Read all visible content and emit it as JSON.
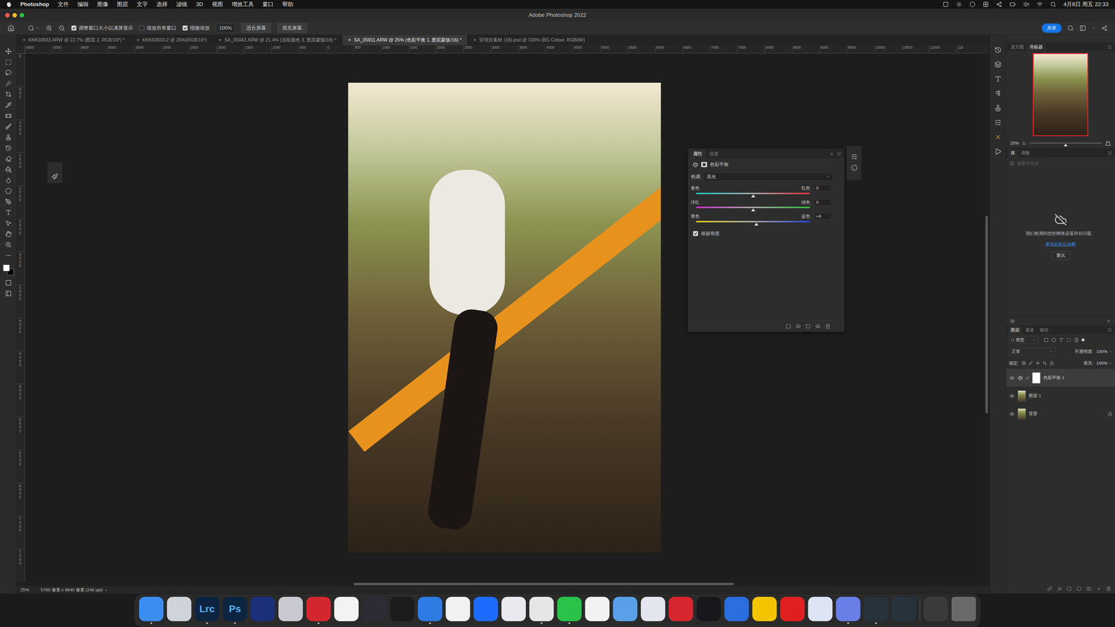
{
  "menubar": {
    "app": "Photoshop",
    "items": [
      "文件",
      "编辑",
      "图像",
      "图层",
      "文字",
      "选择",
      "滤镜",
      "3D",
      "视图",
      "增效工具",
      "窗口",
      "帮助"
    ],
    "clock": "4月8日 周五 22:33"
  },
  "window": {
    "title": "Adobe Photoshop 2022"
  },
  "options_bar": {
    "checkboxes": [
      {
        "label": "调整窗口大小以满屏显示",
        "checked": true
      },
      {
        "label": "缩放所有窗口",
        "checked": false
      },
      {
        "label": "细微缩放",
        "checked": true
      }
    ],
    "zoom": "100%",
    "buttons": [
      "适合屏幕",
      "填充屏幕"
    ],
    "share": "共享"
  },
  "tabs": [
    {
      "label": "KKK02833.ARW @ 22.7% (图层 2, RGB/16*) *",
      "selected": false,
      "close": "×"
    },
    {
      "label": "KKK02833-2 @ 25%(RGB/16*)",
      "selected": false,
      "close": "×"
    },
    {
      "label": "SA_05042.ARW @ 21.4% (选取颜色 3, 图层蒙版/16) *",
      "selected": false,
      "close": "×"
    },
    {
      "label": "SA_05911.ARW @ 25% (色彩平衡 1, 图层蒙版/16) *",
      "selected": true,
      "close": "×"
    },
    {
      "label": "安琪拉素材 (16).psd @ 100% (BG Colour, RGB/8#)",
      "selected": false,
      "close": "×"
    }
  ],
  "rulers": {
    "horizontal": [
      "5500",
      "5000",
      "4500",
      "4000",
      "3500",
      "3000",
      "2500",
      "2000",
      "1500",
      "1000",
      "500",
      "0",
      "500",
      "1000",
      "1500",
      "2000",
      "2500",
      "3000",
      "3500",
      "4000",
      "4500",
      "5000",
      "5500",
      "6000",
      "6500",
      "7000",
      "7500",
      "8000",
      "8500",
      "9000",
      "9500",
      "10000",
      "10500",
      "11000",
      "115"
    ],
    "vertical": [
      "0",
      "500",
      "1000",
      "1500",
      "2000",
      "2500",
      "3000",
      "3500",
      "4000",
      "4500",
      "5000",
      "5500",
      "6000",
      "6500",
      "7000",
      "7500"
    ]
  },
  "status_bar": {
    "zoom": "25%",
    "info": "5760 像素 x 8640 像素 (240 ppi)",
    "arrow": "›"
  },
  "properties": {
    "tabs": [
      {
        "label": "属性",
        "selected": true
      },
      {
        "label": "信息",
        "selected": false
      }
    ],
    "title": "色彩平衡",
    "tone_label": "色调:",
    "tone": "高光",
    "sliders": [
      {
        "left": "青色",
        "right": "红色",
        "value": "0",
        "level": 0.5,
        "left_color": "#19c6c6",
        "right_color": "#e0303a"
      },
      {
        "left": "洋红",
        "right": "绿色",
        "value": "0",
        "level": 0.5,
        "left_color": "#d22fd2",
        "right_color": "#2fbf3a"
      },
      {
        "left": "黄色",
        "right": "蓝色",
        "value": "+6",
        "level": 0.53,
        "left_color": "#e5d21a",
        "right_color": "#2a3ee0"
      }
    ],
    "preserve": {
      "label": "保留明度",
      "checked": true
    }
  },
  "navigator": {
    "tabs": [
      {
        "label": "直方图",
        "selected": false
      },
      {
        "label": "导航器",
        "selected": true
      }
    ],
    "zoom": "25%",
    "level": 0.5
  },
  "libraries": {
    "tabs": [
      {
        "label": "库",
        "selected": true
      },
      {
        "label": "调整",
        "selected": false
      }
    ],
    "search_placeholder": "搜索所有库",
    "message": "我们检测到您的网络设置存在问题。",
    "link": "单击此处以诊断",
    "retry": "重试"
  },
  "layers": {
    "tabs": [
      {
        "label": "图层",
        "selected": true
      },
      {
        "label": "通道",
        "selected": false
      },
      {
        "label": "路径",
        "selected": false
      }
    ],
    "filter": "类型",
    "blend": "正常",
    "opacity_label": "不透明度:",
    "opacity": "100%",
    "lock_label": "锁定:",
    "fill_label": "填充:",
    "fill": "100%",
    "items": [
      {
        "name": "色彩平衡 1",
        "kind": "adjustment",
        "visible": true,
        "selected": true,
        "locked": false
      },
      {
        "name": "图层 1",
        "kind": "pixel",
        "visible": true,
        "selected": false,
        "locked": false
      },
      {
        "name": "背景",
        "kind": "pixel",
        "visible": true,
        "selected": false,
        "locked": true
      }
    ]
  },
  "dock": [
    {
      "kind": "app",
      "label": "",
      "color": "#3b8ef0",
      "label_color": "#ffffff",
      "running": true
    },
    {
      "kind": "app",
      "label": "",
      "color": "#cfd3da",
      "label_color": "#ffffff",
      "running": false
    },
    {
      "kind": "app",
      "label": "Lrc",
      "color": "#0d2440",
      "label_color": "#56b4ff",
      "running": true
    },
    {
      "kind": "app",
      "label": "Ps",
      "color": "#0d2440",
      "label_color": "#56b4ff",
      "running": true
    },
    {
      "kind": "app",
      "label": "",
      "color": "#1b2f7a",
      "label_color": "#ffffff",
      "running": false
    },
    {
      "kind": "app",
      "label": "",
      "color": "#c9c9d2",
      "label_color": "#ffffff",
      "running": false
    },
    {
      "kind": "app",
      "label": "",
      "color": "#d3262e",
      "label_color": "#ffffff",
      "running": true
    },
    {
      "kind": "app",
      "label": "",
      "color": "#f3f3f3",
      "label_color": "#ffffff",
      "running": false
    },
    {
      "kind": "app",
      "label": "",
      "color": "#2c2c34",
      "label_color": "#ffffff",
      "running": false
    },
    {
      "kind": "app",
      "label": "",
      "color": "#1c1c1c",
      "label_color": "#ffffff",
      "running": false
    },
    {
      "kind": "app",
      "label": "",
      "color": "#2f7be4",
      "label_color": "#ffffff",
      "running": true
    },
    {
      "kind": "app",
      "label": "",
      "color": "#f1f1f1",
      "label_color": "#ffffff",
      "running": false
    },
    {
      "kind": "app",
      "label": "",
      "color": "#1e6cff",
      "label_color": "#ffffff",
      "running": false
    },
    {
      "kind": "app",
      "label": "",
      "color": "#e9e9ef",
      "label_color": "#ffffff",
      "running": false
    },
    {
      "kind": "app",
      "label": "",
      "color": "#e6e6e6",
      "label_color": "#ffffff",
      "running": true
    },
    {
      "kind": "app",
      "label": "",
      "color": "#2bc24a",
      "label_color": "#ffffff",
      "running": true
    },
    {
      "kind": "app",
      "label": "",
      "color": "#f2f2f2",
      "label_color": "#ffffff",
      "running": false
    },
    {
      "kind": "app",
      "label": "",
      "color": "#5aa0e8",
      "label_color": "#ffffff",
      "running": false
    },
    {
      "kind": "app",
      "label": "",
      "color": "#e3e6ee",
      "label_color": "#ffffff",
      "running": false
    },
    {
      "kind": "app",
      "label": "",
      "color": "#d72630",
      "label_color": "#ffffff",
      "running": false
    },
    {
      "kind": "app",
      "label": "",
      "color": "#18181c",
      "label_color": "#ffffff",
      "running": false
    },
    {
      "kind": "app",
      "label": "",
      "color": "#2a6ee0",
      "label_color": "#ffffff",
      "running": false
    },
    {
      "kind": "app",
      "label": "",
      "color": "#f5c400",
      "label_color": "#ffffff",
      "running": false
    },
    {
      "kind": "app",
      "label": "",
      "color": "#e02020",
      "label_color": "#ffffff",
      "running": false
    },
    {
      "kind": "app",
      "label": "",
      "color": "#dde5f5",
      "label_color": "#ffffff",
      "running": false
    },
    {
      "kind": "app",
      "label": "",
      "color": "#6a7ee8",
      "label_color": "#ffffff",
      "running": true
    },
    {
      "kind": "app",
      "label": "",
      "color": "#26323c",
      "label_color": "#ffffff",
      "running": true
    },
    {
      "kind": "app",
      "label": "",
      "color": "#26323c",
      "label_color": "#ffffff",
      "running": false
    },
    {
      "kind": "separator",
      "label": "",
      "color": "#555555",
      "label_color": "#ffffff",
      "running": false
    },
    {
      "kind": "app",
      "label": "",
      "color": "#3a3a3a",
      "label_color": "#ffffff",
      "running": false
    },
    {
      "kind": "trash",
      "label": "",
      "color": "#6a6a6a",
      "label_color": "#ffffff",
      "running": false
    }
  ]
}
